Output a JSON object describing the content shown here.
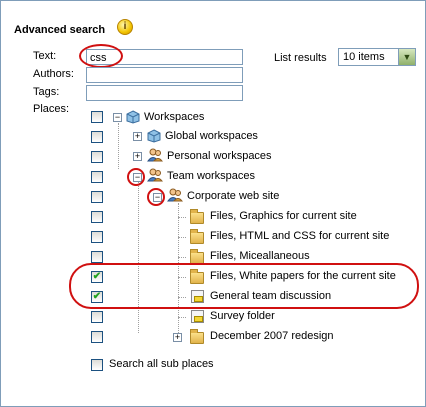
{
  "header": {
    "title": "Advanced search",
    "info_icon": "info-icon"
  },
  "form": {
    "text_label": "Text:",
    "text_value": "css",
    "authors_label": "Authors:",
    "authors_value": "",
    "tags_label": "Tags:",
    "tags_value": "",
    "places_label": "Places:",
    "list_results_label": "List results",
    "list_results_value": "10 items"
  },
  "tree": {
    "nodes": [
      {
        "label": "Workspaces",
        "checked": false,
        "icon": "cube-icon"
      },
      {
        "label": "Global workspaces",
        "checked": false,
        "icon": "cube-icon"
      },
      {
        "label": "Personal workspaces",
        "checked": false,
        "icon": "people-icon"
      },
      {
        "label": "Team workspaces",
        "checked": false,
        "icon": "people-icon"
      },
      {
        "label": "Corporate web site",
        "checked": false,
        "icon": "people-icon"
      },
      {
        "label": "Files, Graphics for current site",
        "checked": false,
        "icon": "folder-icon"
      },
      {
        "label": "Files, HTML and CSS for current site",
        "checked": false,
        "icon": "folder-icon"
      },
      {
        "label": "Files, Miceallaneous",
        "checked": false,
        "icon": "folder-icon"
      },
      {
        "label": "Files, White papers for the current site",
        "checked": true,
        "icon": "folder-icon"
      },
      {
        "label": "General team discussion",
        "checked": true,
        "icon": "discussion-icon"
      },
      {
        "label": "Survey folder",
        "checked": false,
        "icon": "discussion-icon"
      },
      {
        "label": "December 2007 redesign",
        "checked": false,
        "icon": "folder-icon"
      }
    ]
  },
  "search_all": {
    "label": "Search all sub places",
    "checked": false
  },
  "colors": {
    "annotation_red": "#d01010",
    "field_border": "#7f9db9",
    "check_green": "#21a121"
  }
}
